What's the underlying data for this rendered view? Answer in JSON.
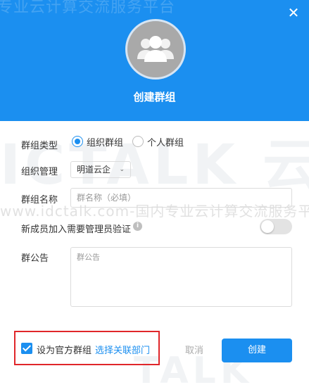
{
  "header": {
    "watermark": "专业云计算交流服务平台",
    "title": "创建群组",
    "close_symbol": "✕"
  },
  "watermarks": {
    "brand_large": "ICTALK 云计",
    "url_line": "www.idctalk.com-国内专业云计算交流服务平",
    "brand_bottom": "TALK"
  },
  "form": {
    "type_label": "群组类型",
    "type_options": [
      "组织群组",
      "个人群组"
    ],
    "type_selected": "组织群组",
    "org_label": "组织管理",
    "org_value": "明道云企",
    "name_label": "群组名称",
    "name_placeholder": "群名称（必填）",
    "verify_label": "新成员加入需要管理员验证",
    "verify_info_symbol": "i",
    "notice_label": "群公告",
    "notice_placeholder": "群公告"
  },
  "footer": {
    "official_checkbox_label": "设为官方群组",
    "select_dept_link": "选择关联部门",
    "cancel_label": "取消",
    "create_label": "创建"
  },
  "colors": {
    "accent": "#1b8ff0",
    "highlight_border": "#e0262a"
  },
  "icons": {
    "avatar": "group-people-icon",
    "close": "close-icon",
    "info": "info-icon",
    "dropdown": "chevron-down-icon"
  }
}
